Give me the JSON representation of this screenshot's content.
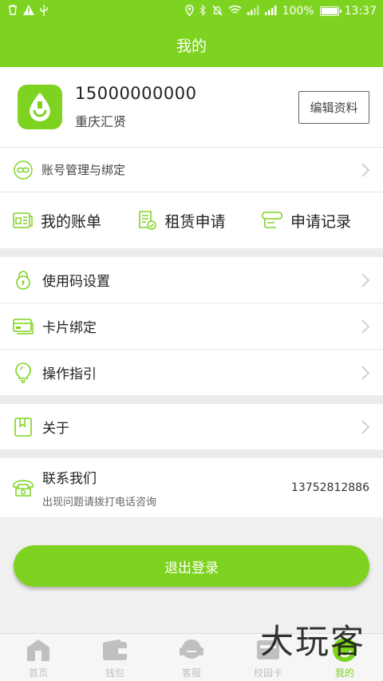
{
  "status_bar": {
    "battery": "100%",
    "time": "13:37"
  },
  "header": {
    "title": "我的"
  },
  "profile": {
    "phone": "15000000000",
    "name": "重庆汇贤",
    "edit_label": "编辑资料"
  },
  "account": {
    "label": "账号管理与绑定"
  },
  "quick_actions": [
    {
      "label": "我的账单",
      "icon": "bill-icon"
    },
    {
      "label": "租赁申请",
      "icon": "lease-apply-icon"
    },
    {
      "label": "申请记录",
      "icon": "apply-record-icon"
    }
  ],
  "menu": [
    {
      "label": "使用码设置",
      "icon": "lock-icon"
    },
    {
      "label": "卡片绑定",
      "icon": "card-icon"
    },
    {
      "label": "操作指引",
      "icon": "bulb-icon"
    }
  ],
  "about": {
    "label": "关于"
  },
  "contact": {
    "title": "联系我们",
    "subtitle": "出现问题请拨打电话咨询",
    "number": "13752812886"
  },
  "logout": {
    "label": "退出登录"
  },
  "tabs": [
    {
      "label": "首页",
      "active": false
    },
    {
      "label": "钱包",
      "active": false
    },
    {
      "label": "客服",
      "active": false
    },
    {
      "label": "校园卡",
      "active": false
    },
    {
      "label": "我的",
      "active": true
    }
  ],
  "watermark": "大玩客",
  "colors": {
    "accent": "#7ed321",
    "icon": "#7ed321",
    "inactive_tab": "#c0c0c0"
  }
}
